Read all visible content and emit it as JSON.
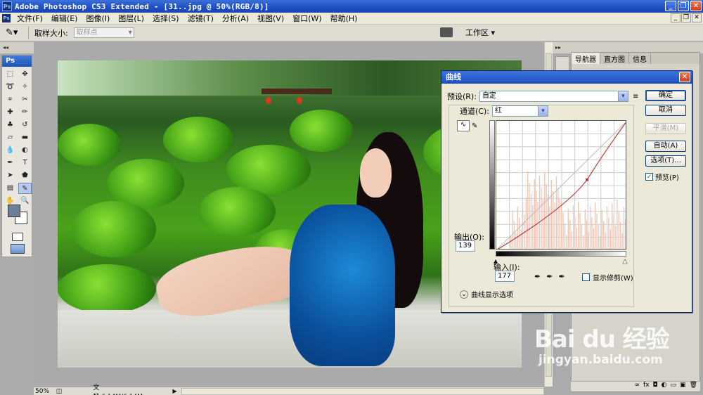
{
  "window": {
    "title": "Adobe Photoshop CS3 Extended - [31..jpg @ 50%(RGB/8)]",
    "app_icon": "Ps"
  },
  "menu": [
    "文件(F)",
    "编辑(E)",
    "图像(I)",
    "图层(L)",
    "选择(S)",
    "滤镜(T)",
    "分析(A)",
    "视图(V)",
    "窗口(W)",
    "帮助(H)"
  ],
  "options": {
    "sample_size_label": "取样大小:",
    "sample_size_value": "取样点",
    "workspace_label": "工作区 ▾"
  },
  "toolbox": {
    "logo": "Ps"
  },
  "status": {
    "zoom": "50%",
    "doc": "文档:6.14M/6.14M"
  },
  "panels": {
    "tabs": [
      "导航器",
      "直方图",
      "信息"
    ]
  },
  "curves_dialog": {
    "title": "曲线",
    "preset_label": "预设(R):",
    "preset_value": "自定",
    "channel_label": "通道(C):",
    "channel_value": "红",
    "output_label": "输出(O):",
    "output_value": "139",
    "input_label": "输入(I):",
    "input_value": "177",
    "show_clipping_label": "显示修剪(W)",
    "display_options_label": "曲线显示选项",
    "buttons": {
      "ok": "确定",
      "cancel": "取消",
      "smooth": "平滑(M)",
      "auto": "自动(A)",
      "options": "选项(T)..."
    },
    "preview_label": "预览(P)",
    "preview_checked": true,
    "control_point": {
      "input": 177,
      "output": 139
    },
    "curve_color": "#b8403a"
  },
  "watermark": {
    "brand": "Bai du 经验",
    "url": "jingyan.baidu.com"
  }
}
